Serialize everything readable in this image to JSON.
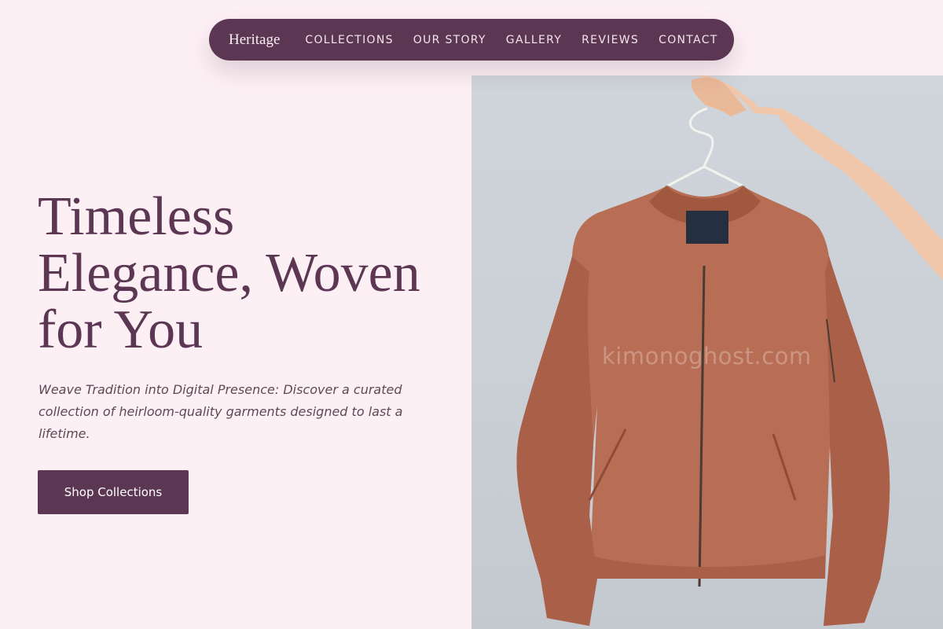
{
  "nav": {
    "brand": "Heritage",
    "links": [
      "COLLECTIONS",
      "OUR STORY",
      "GALLERY",
      "REVIEWS",
      "CONTACT"
    ]
  },
  "hero": {
    "title": "Timeless Elegance, Woven for You",
    "subtitle": "Weave Tradition into Digital Presence: Discover a curated collection of heirloom-quality garments designed to last a lifetime.",
    "cta_label": "Shop Collections",
    "image_watermark": "kimonoghost.com"
  },
  "colors": {
    "background": "#fdf0f5",
    "accent": "#5c3753",
    "jacket": "#b86e55"
  }
}
